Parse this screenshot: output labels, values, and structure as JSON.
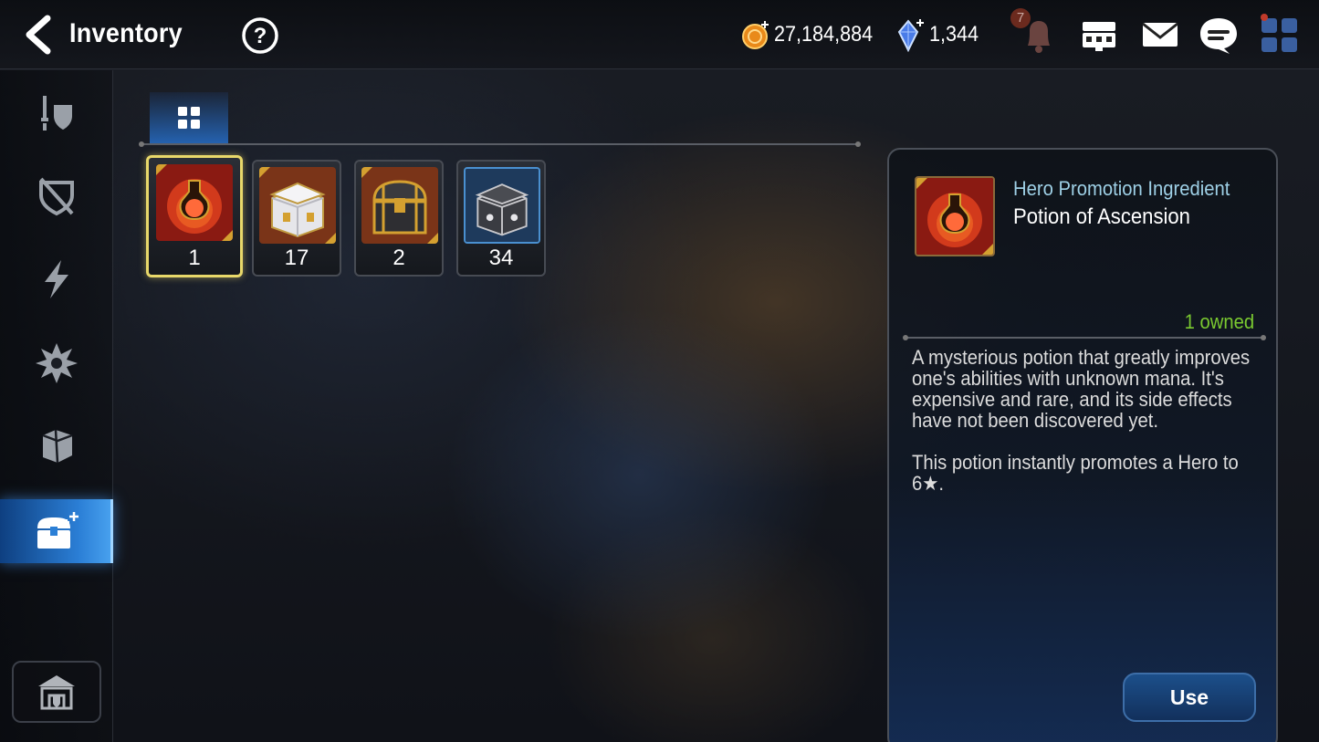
{
  "header": {
    "title": "Inventory",
    "back_icon": "back-arrow-icon",
    "help_icon": "help-icon"
  },
  "currencies": [
    {
      "name": "gold",
      "icon": "gold-coin-icon",
      "value": "27,184,884"
    },
    {
      "name": "crystal",
      "icon": "crystal-icon",
      "value": "1,344"
    }
  ],
  "top_icons": {
    "notification_badge": "7",
    "notification_icon": "bell-icon",
    "shop_icon": "shop-icon",
    "mail_icon": "mail-icon",
    "chat_icon": "chat-icon",
    "menu_icon": "grid-menu-icon"
  },
  "sidebar": {
    "items": [
      {
        "icon": "equipment-icon",
        "active": false
      },
      {
        "icon": "no-equipment-icon",
        "active": false
      },
      {
        "icon": "lightning-icon",
        "active": false
      },
      {
        "icon": "artifact-icon",
        "active": false
      },
      {
        "icon": "material-icon",
        "active": false
      },
      {
        "icon": "chest-icon",
        "active": true
      }
    ],
    "base_icon": "sanctuary-icon"
  },
  "tabs": [
    {
      "icon": "grid-icon",
      "active": true
    }
  ],
  "items": [
    {
      "name": "Potion of Ascension",
      "count": "1",
      "selected": true
    },
    {
      "name": "silver-chest",
      "count": "17",
      "selected": false
    },
    {
      "name": "gold-chest",
      "count": "2",
      "selected": false
    },
    {
      "name": "dark-chest",
      "count": "34",
      "selected": false
    }
  ],
  "detail": {
    "category": "Hero Promotion Ingredient",
    "name": "Potion of Ascension",
    "owned": "1 owned",
    "description_1": "A mysterious potion that greatly improves one's abilities with unknown mana. It's expensive and rare, and its side effects have not been discovered yet.",
    "description_2": "This potion instantly promotes a Hero to 6★.",
    "use_label": "Use"
  },
  "colors": {
    "accent_blue": "#2b7fd6",
    "owned_green": "#7ac930",
    "selected_border": "#e8d86a",
    "category_text": "#9ed0e6"
  }
}
